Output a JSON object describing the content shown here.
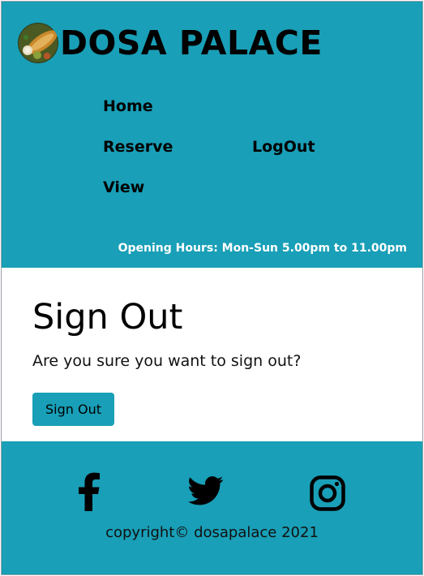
{
  "header": {
    "brand_name": "DOSA PALACE",
    "logo_icon": "dosa-plate-logo",
    "nav": {
      "home": "Home",
      "reserve": "Reserve",
      "view": "View",
      "logout": "LogOut"
    },
    "opening_hours": "Opening Hours: Mon-Sun 5.00pm to 11.00pm"
  },
  "main": {
    "title": "Sign Out",
    "question": "Are you sure you want to sign out?",
    "signout_button": "Sign Out"
  },
  "footer": {
    "social_icons": [
      "facebook-icon",
      "twitter-icon",
      "instagram-icon"
    ],
    "copyright": "copyright© dosapalace 2021"
  },
  "colors": {
    "brand": "#199fb7",
    "text": "#000000",
    "hours_text": "#ffffff"
  }
}
